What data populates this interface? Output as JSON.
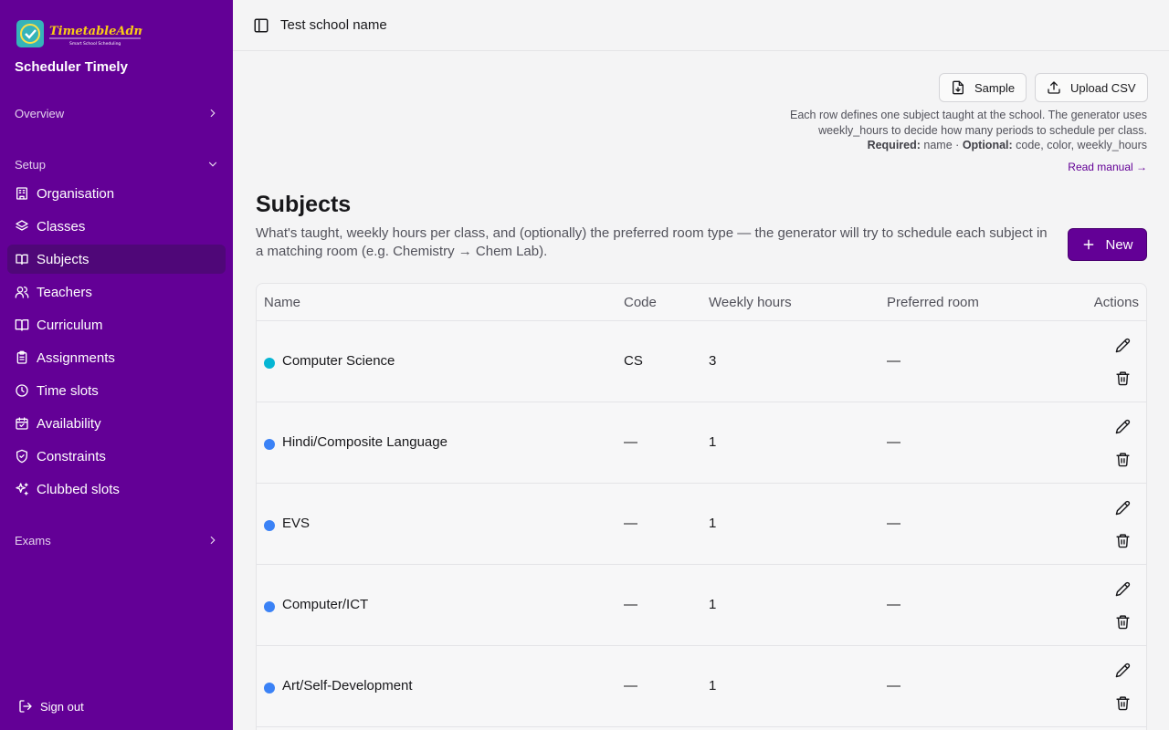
{
  "sidebar": {
    "logo_text": "TimetableAdmin",
    "logo_tagline": "Smart School Scheduling",
    "app_name": "Scheduler Timely",
    "groups": {
      "overview": "Overview",
      "setup": "Setup",
      "exams": "Exams"
    },
    "items": [
      {
        "label": "Organisation",
        "icon": "building-icon"
      },
      {
        "label": "Classes",
        "icon": "layers-icon"
      },
      {
        "label": "Subjects",
        "icon": "book-icon",
        "active": true
      },
      {
        "label": "Teachers",
        "icon": "users-icon"
      },
      {
        "label": "Curriculum",
        "icon": "book-open-icon"
      },
      {
        "label": "Assignments",
        "icon": "clipboard-icon"
      },
      {
        "label": "Time slots",
        "icon": "clock-icon"
      },
      {
        "label": "Availability",
        "icon": "calendar-check-icon"
      },
      {
        "label": "Constraints",
        "icon": "shield-check-icon"
      },
      {
        "label": "Clubbed slots",
        "icon": "sparkles-icon"
      }
    ],
    "sign_out": "Sign out"
  },
  "topbar": {
    "school_name": "Test school name"
  },
  "actions": {
    "sample_label": "Sample",
    "upload_label": "Upload CSV",
    "help_line1": "Each row defines one subject taught at the school. The generator uses",
    "help_line2": "weekly_hours to decide how many periods to schedule per class.",
    "required_label": "Required:",
    "required_value": "name",
    "separator": "·",
    "optional_label": "Optional:",
    "optional_value": "code, color, weekly_hours",
    "read_manual": "Read manual →"
  },
  "page": {
    "title": "Subjects",
    "subtitle": "What's taught, weekly hours per class, and (optionally) the preferred room type — the generator will try to schedule each subject in a matching room (e.g. Chemistry → Chem Lab).",
    "new_label": "New"
  },
  "table": {
    "headers": {
      "name": "Name",
      "code": "Code",
      "weekly_hours": "Weekly hours",
      "preferred_room": "Preferred room",
      "actions": "Actions"
    },
    "rows": [
      {
        "name": "Computer Science",
        "color": "#06b6d4",
        "code": "CS",
        "weekly_hours": "3",
        "preferred_room": "—"
      },
      {
        "name": "Hindi/Composite Language",
        "color": "#3b82f6",
        "code": "—",
        "weekly_hours": "1",
        "preferred_room": "—"
      },
      {
        "name": "EVS",
        "color": "#3b82f6",
        "code": "—",
        "weekly_hours": "1",
        "preferred_room": "—"
      },
      {
        "name": "Computer/ICT",
        "color": "#3b82f6",
        "code": "—",
        "weekly_hours": "1",
        "preferred_room": "—"
      },
      {
        "name": "Art/Self-Development",
        "color": "#3b82f6",
        "code": "—",
        "weekly_hours": "1",
        "preferred_room": "—"
      }
    ]
  },
  "colors": {
    "brand": "#630096",
    "brand_active": "#4f0778"
  }
}
